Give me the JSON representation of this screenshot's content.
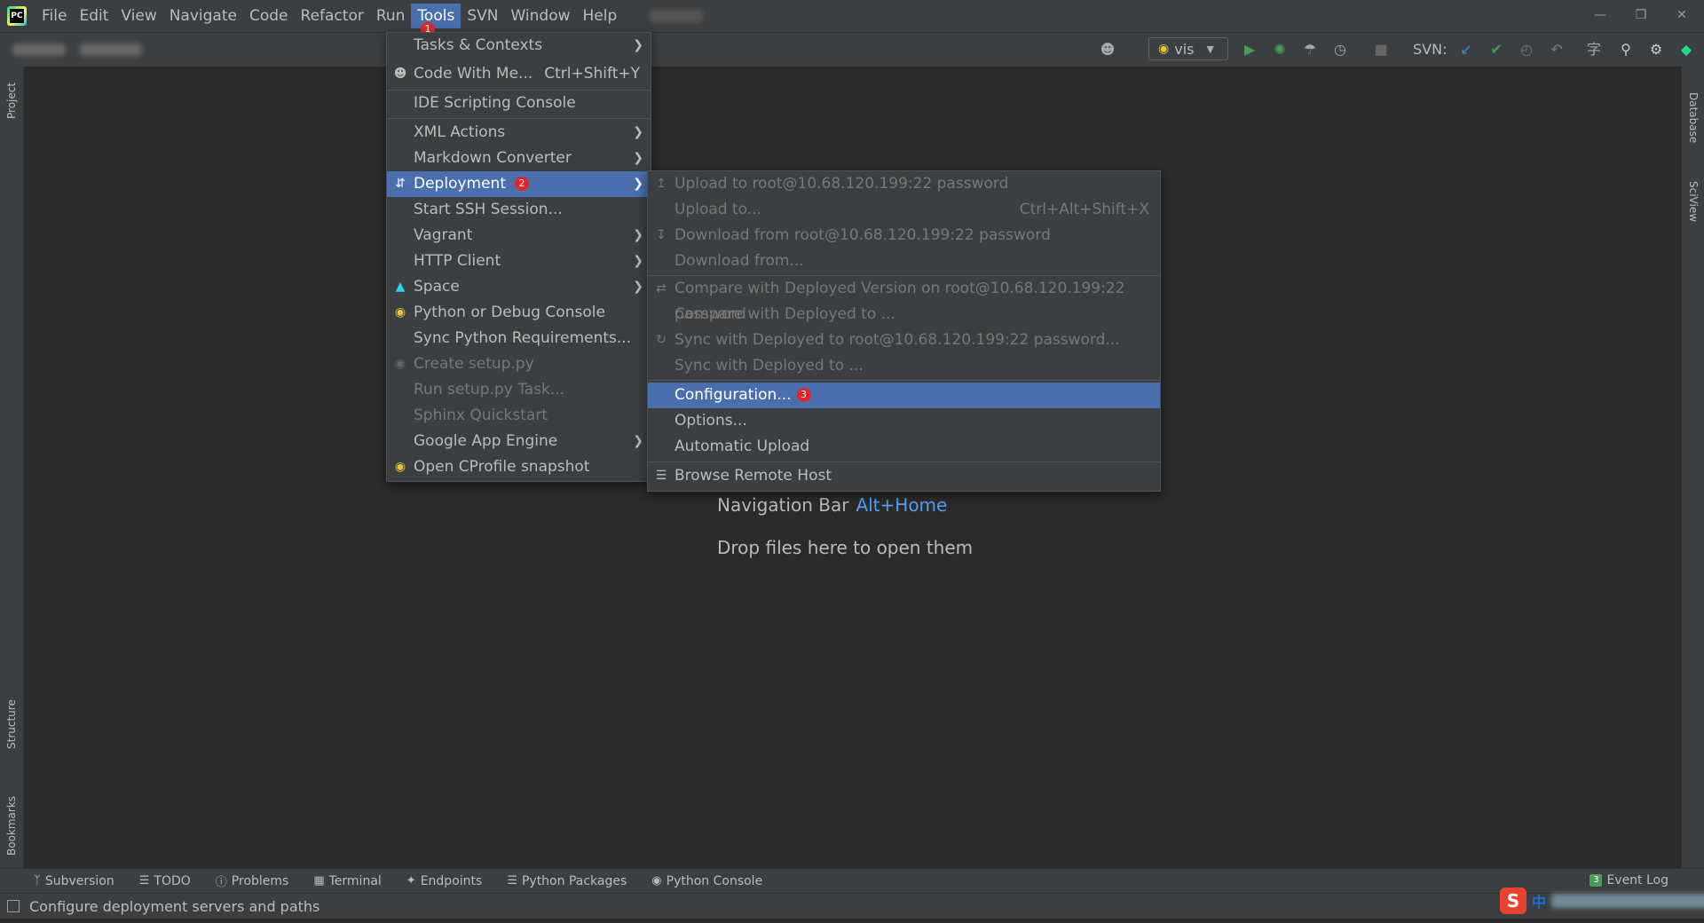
{
  "menubar": {
    "items": [
      "File",
      "Edit",
      "View",
      "Navigate",
      "Code",
      "Refactor",
      "Run",
      "Tools",
      "SVN",
      "Window",
      "Help"
    ],
    "active_item": "Tools"
  },
  "toolbar": {
    "run_config": "vis",
    "svn_label": "SVN:"
  },
  "side_tabs": {
    "left_top": "Project",
    "left_mid": "Structure",
    "left_bottom": "Bookmarks",
    "right_top": "Database",
    "right_mid": "SciView"
  },
  "tools_menu": {
    "badge": "1",
    "items": [
      {
        "label": "Tasks & Contexts",
        "has_submenu": true,
        "enabled": true
      },
      {
        "label": "Code With Me...",
        "shortcut": "Ctrl+Shift+Y",
        "icon": "user-icon",
        "enabled": true
      },
      {
        "label": "IDE Scripting Console",
        "enabled": true
      },
      {
        "label": "XML Actions",
        "has_submenu": true,
        "enabled": true
      },
      {
        "label": "Markdown Converter",
        "has_submenu": true,
        "enabled": true
      },
      {
        "label": "Deployment",
        "has_submenu": true,
        "selected": true,
        "badge": "2",
        "icon": "deploy-icon",
        "enabled": true
      },
      {
        "label": "Start SSH Session...",
        "enabled": true
      },
      {
        "label": "Vagrant",
        "has_submenu": true,
        "enabled": true
      },
      {
        "label": "HTTP Client",
        "has_submenu": true,
        "enabled": true
      },
      {
        "label": "Space",
        "has_submenu": true,
        "icon": "space-icon",
        "enabled": true
      },
      {
        "label": "Python or Debug Console",
        "icon": "python-icon",
        "enabled": true
      },
      {
        "label": "Sync Python Requirements...",
        "enabled": true
      },
      {
        "label": "Create setup.py",
        "icon": "python-icon",
        "enabled": false
      },
      {
        "label": "Run setup.py Task...",
        "enabled": false
      },
      {
        "label": "Sphinx Quickstart",
        "enabled": false
      },
      {
        "label": "Google App Engine",
        "has_submenu": true,
        "enabled": true
      },
      {
        "label": "Open CProfile snapshot",
        "icon": "python-icon",
        "enabled": true
      }
    ]
  },
  "deployment_menu": {
    "items": [
      {
        "label": "Upload to root@10.68.120.199:22 password",
        "icon": "upload-icon",
        "enabled": false
      },
      {
        "label": "Upload to...",
        "shortcut": "Ctrl+Alt+Shift+X",
        "enabled": false
      },
      {
        "label": "Download from root@10.68.120.199:22 password",
        "icon": "download-icon",
        "enabled": false
      },
      {
        "label": "Download from...",
        "enabled": false
      },
      {
        "label": "Compare with Deployed Version on root@10.68.120.199:22 password",
        "icon": "compare-icon",
        "enabled": false
      },
      {
        "label": "Compare with Deployed to ...",
        "enabled": false
      },
      {
        "label": "Sync with Deployed to root@10.68.120.199:22 password...",
        "icon": "sync-icon",
        "enabled": false
      },
      {
        "label": "Sync with Deployed to ...",
        "enabled": false
      },
      {
        "label": "Configuration...",
        "selected": true,
        "badge": "3",
        "enabled": true
      },
      {
        "label": "Options...",
        "enabled": true
      },
      {
        "label": "Automatic Upload",
        "enabled": true
      },
      {
        "label": "Browse Remote Host",
        "icon": "list-icon",
        "enabled": true
      }
    ]
  },
  "editor_hints": {
    "nav_bar_label": "Navigation Bar",
    "nav_bar_shortcut": "Alt+Home",
    "drop_files": "Drop files here to open them"
  },
  "bottom_tools": [
    "Subversion",
    "TODO",
    "Problems",
    "Terminal",
    "Endpoints",
    "Python Packages",
    "Python Console"
  ],
  "event_log": {
    "count": "3",
    "label": "Event Log"
  },
  "status": {
    "text": "Configure deployment servers and paths"
  },
  "ime": {
    "logo": "S",
    "lang": "中"
  },
  "colors": {
    "accent": "#4b6eaf",
    "badge": "#e0262a",
    "link": "#589df6",
    "background": "#2b2b2b",
    "panel": "#3c3f41"
  }
}
